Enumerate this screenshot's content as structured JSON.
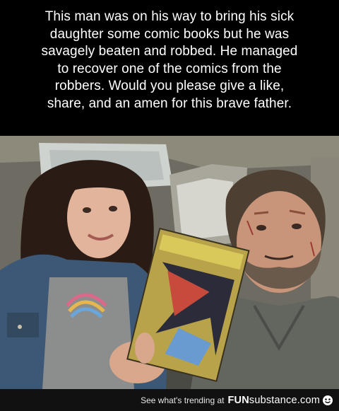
{
  "caption": {
    "lines": [
      "This man was on his way to bring his sick",
      "daughter some comic books but he was",
      "savagely beaten and robbed. He managed",
      "to recover one of the comics from the",
      "robbers. Would you please give a like,",
      "share, and an amen for this brave father."
    ]
  },
  "footer": {
    "trending_text": "See what's trending at",
    "brand_bold": "FUN",
    "brand_light": "substance.com"
  },
  "photo": {
    "description_icon": "selfie-photo",
    "colors": {
      "jacket": "#3d5877",
      "shirt": "#8b8e8c",
      "hair_girl": "#2a1b14",
      "beard": "#6a5a4c",
      "skin": "#d8a78c",
      "comic": "#b8a34a"
    }
  }
}
